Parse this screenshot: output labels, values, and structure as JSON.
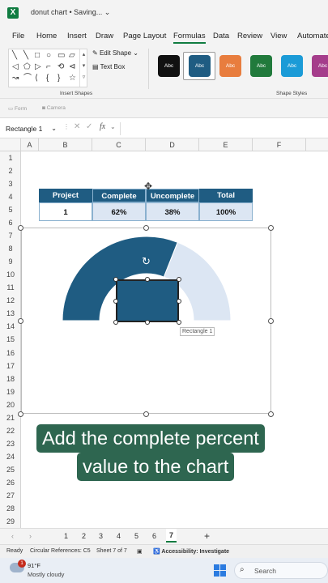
{
  "window": {
    "app_letter": "X",
    "title": "donut chart • Saving... ⌄"
  },
  "ribbon_tabs": [
    "File",
    "Home",
    "Insert",
    "Draw",
    "Page Layout",
    "Formulas",
    "Data",
    "Review",
    "View",
    "Automate"
  ],
  "ribbon": {
    "shape_icons": [
      "╲",
      "╲",
      "□",
      "○",
      "▭",
      "▱",
      "◁",
      "⬠",
      "▷",
      "⌐",
      "⟲",
      "⊲",
      "↝",
      "⌒",
      "⟨",
      "{",
      "}",
      "☆"
    ],
    "edit_shape": "Edit Shape ⌄",
    "text_box": "Text Box",
    "insert_shapes_label": "Insert Shapes",
    "shape_styles_label": "Shape Styles",
    "style_text": "Abc",
    "style_colors": [
      "#111111",
      "#1f5c82",
      "#e87d3e",
      "#217a3c",
      "#1b9bd7",
      "#a53d8b"
    ]
  },
  "quickbar": {
    "form": "Form",
    "camera": "Camera"
  },
  "formula_bar": {
    "name_box": "Rectangle 1",
    "value": ""
  },
  "grid": {
    "columns": [
      "A",
      "B",
      "C",
      "D",
      "E",
      "F"
    ],
    "rows": [
      "1",
      "2",
      "3",
      "4",
      "5",
      "6",
      "7",
      "8",
      "9",
      "10",
      "11",
      "12",
      "13",
      "14",
      "15",
      "16",
      "17",
      "18",
      "19",
      "20",
      "21",
      "22",
      "23",
      "24",
      "25",
      "26",
      "27",
      "28",
      "29"
    ]
  },
  "table": {
    "headers": [
      "Project",
      "Complete",
      "Uncomplete",
      "Total"
    ],
    "row": [
      "1",
      "62%",
      "38%",
      "100%"
    ]
  },
  "chart_data": {
    "type": "pie",
    "subtype": "half-donut",
    "categories": [
      "Complete",
      "Uncomplete"
    ],
    "values": [
      62,
      38
    ],
    "colors": [
      "#1f5c82",
      "#dce6f3"
    ],
    "title": ""
  },
  "chart": {
    "rect_tooltip": "Rectangle 1"
  },
  "caption": {
    "line1": "Add the complete percent",
    "line2": "value to the chart"
  },
  "sheet_tabs": {
    "tabs": [
      "1",
      "2",
      "3",
      "4",
      "5",
      "6",
      "7"
    ],
    "active": "7",
    "add": "+"
  },
  "status": {
    "ready": "Ready",
    "circular": "Circular References: C5",
    "sheet": "Sheet 7 of 7",
    "accessibility": "Accessibility: Investigate"
  },
  "taskbar": {
    "temp": "91°F",
    "weather": "Mostly cloudy",
    "badge": "1",
    "search": "Search"
  }
}
